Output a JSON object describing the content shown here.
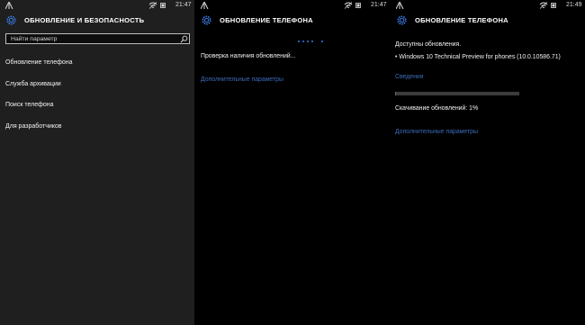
{
  "accent_color": "#3c6bb8",
  "panels": [
    {
      "time": "21:47",
      "title": "ОБНОВЛЕНИЕ И БЕЗОПАСНОСТЬ",
      "search": {
        "placeholder": "Найти параметр"
      },
      "menu": [
        {
          "label": "Обновление телефона"
        },
        {
          "label": "Служба архивации"
        },
        {
          "label": "Поиск телефона"
        },
        {
          "label": "Для разработчиков"
        }
      ]
    },
    {
      "time": "21:47",
      "title": "ОБНОВЛЕНИЕ ТЕЛЕФОНА",
      "checking_text": "Проверка наличия обновлений...",
      "advanced_link": "Дополнительные параметры"
    },
    {
      "time": "21:49",
      "title": "ОБНОВЛЕНИЕ ТЕЛЕФОНА",
      "available_text": "Доступны обновления.",
      "update_item": "• Windows 10 Technical Preview for phones (10.0.10586.71)",
      "details_link": "Сведения",
      "progress": 0.01,
      "download_text": "Скачивание обновлений: 1%",
      "advanced_link": "Дополнительные параметры"
    }
  ]
}
